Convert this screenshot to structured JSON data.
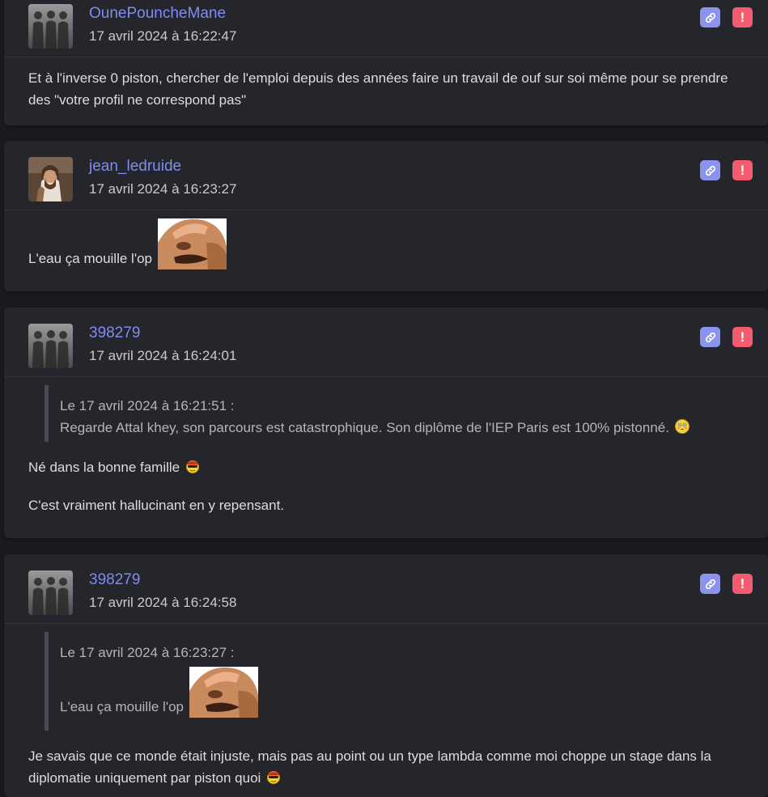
{
  "posts": [
    {
      "author": "OunePouncheMane",
      "date": "17 avril 2024 à 16:22:47",
      "text": "Et à l'inverse 0 piston, chercher de l'emploi depuis des années faire un travail de ouf sur soi même pour se prendre des \"votre profil ne correspond pas\""
    },
    {
      "author": "jean_ledruide",
      "date": "17 avril 2024 à 16:23:27",
      "text": "L'eau ça mouille l'op"
    },
    {
      "author": "398279",
      "date": "17 avril 2024 à 16:24:01",
      "quote_header": "Le 17 avril 2024 à 16:21:51 :",
      "quote_text": "Regarde Attal khey, son parcours est catastrophique. Son diplôme de l'IEP Paris est 100% pistonné.",
      "line1": "Né dans la bonne famille",
      "line2": "C'est vraiment hallucinant en y repensant."
    },
    {
      "author": "398279",
      "date": "17 avril 2024 à 16:24:58",
      "quote_header": "Le 17 avril 2024 à 16:23:27 :",
      "quote_text": "L'eau ça mouille l'op",
      "text": "Je savais que ce monde était injuste, mais pas au point ou un type lambda comme moi choppe un stage dans la diplomatie uniquement par piston quoi"
    }
  ],
  "icons": {
    "link": "link-icon",
    "report": "exclamation-icon",
    "emoji_blush": "flushed-smiley-icon",
    "emoji_sunglasses": "cool-smiley-icon"
  },
  "buttons": {
    "report_glyph": "!"
  },
  "colors": {
    "background": "#1a1b1e",
    "card": "#25262b",
    "author": "#7f8cf0",
    "link_button": "#8b93f0",
    "report_button": "#f55b6e"
  }
}
